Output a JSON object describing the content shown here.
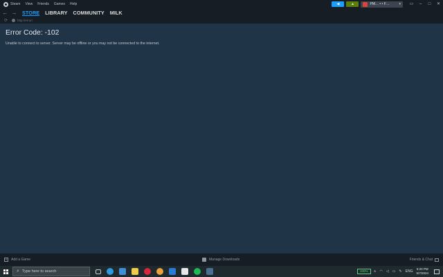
{
  "menu": {
    "app_name": "Steam",
    "items": [
      "View",
      "Friends",
      "Games",
      "Help"
    ]
  },
  "header": {
    "account_name": "PM… • • F…",
    "window_controls": {
      "monitor": "▭",
      "minimize": "–",
      "maximize": "□",
      "close": "✕"
    }
  },
  "nav": {
    "back": "←",
    "forward": "→",
    "tabs": [
      "STORE",
      "LIBRARY",
      "COMMUNITY",
      "MILK"
    ],
    "active_tab": "STORE"
  },
  "urlbar": {
    "url": "http://error/"
  },
  "error": {
    "title": "Error Code: -102",
    "message": "Unable to connect to server. Server may be offline or you may not be connected to the internet."
  },
  "bottombar": {
    "add_game": "Add a Game",
    "manage_downloads": "Manage Downloads",
    "friends_chat": "Friends & Chat"
  },
  "taskbar": {
    "search_placeholder": "Type here to search",
    "battery": "100%",
    "language": "ENG",
    "time": "6:20 PM",
    "date": "5/7/2024",
    "pinned_icons": [
      {
        "name": "edge-icon",
        "color": "#2e9be0"
      },
      {
        "name": "photos-icon",
        "color": "#3d8fd6"
      },
      {
        "name": "file-explorer-icon",
        "color": "#f2c94c"
      },
      {
        "name": "opera-icon",
        "color": "#d7263d"
      },
      {
        "name": "chrome-icon",
        "color": "#e8a33c"
      },
      {
        "name": "outlook-icon",
        "color": "#2a7bd4"
      },
      {
        "name": "gmail-icon",
        "color": "#e8e8e8"
      },
      {
        "name": "spotify-icon",
        "color": "#1db954"
      },
      {
        "name": "steam-taskbar-icon",
        "color": "#4a7090"
      }
    ]
  },
  "colors": {
    "accent": "#1a9fff",
    "content_bg": "#203448",
    "chrome_bg": "#171d25"
  }
}
